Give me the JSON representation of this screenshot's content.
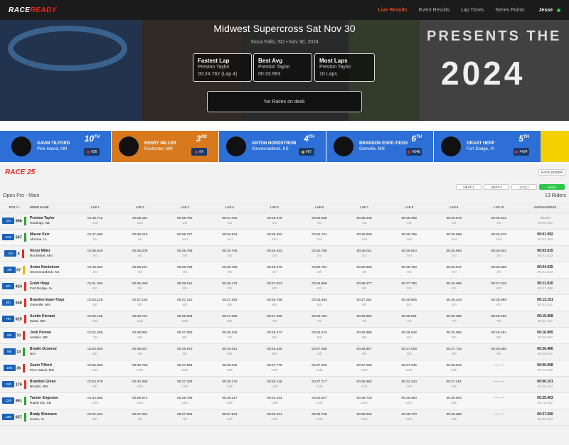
{
  "nav": {
    "logo_a": "RACE",
    "logo_b": "READY",
    "links": [
      "Live Results",
      "Event Results",
      "Lap Times",
      "Series Points"
    ],
    "active": "Live Results",
    "user": "Jesse"
  },
  "hero": {
    "title": "Midwest Supercross Sat Nov 30",
    "subtitle": "Sioux Falls, SD • Nov 30, 2024",
    "stats": [
      {
        "label": "Fastest Lap",
        "name": "Preston Taylor",
        "value": "00:24.762 (Lap 4)"
      },
      {
        "label": "Best Avg",
        "name": "Preston Taylor",
        "value": "00:33.993"
      },
      {
        "label": "Most Laps",
        "name": "Preston Taylor",
        "value": "10 Laps"
      }
    ],
    "ondeck": "No Races on deck",
    "art_text_a": "PRESENTS THE",
    "art_text_b": "2024"
  },
  "recent": [
    {
      "name": "GAVIN TILFORD",
      "loc": "Pine Island, MN",
      "pos": "10",
      "sup": "TH",
      "num": "#36",
      "color": "#2d6fd6",
      "dot": "#e8281e"
    },
    {
      "name": "HENRY MILLER",
      "loc": "Rochester, MN",
      "pos": "3",
      "sup": "RD",
      "num": "#X",
      "color": "#d9791e",
      "dot": "#e8281e"
    },
    {
      "name": "ANTON NORDSTROM",
      "loc": "Stromsnasbruk, KS",
      "pos": "4",
      "sup": "TH",
      "num": "#67",
      "color": "#2d6fd6",
      "dot": "#f4b400"
    },
    {
      "name": "BRANDON ESPE-TIEGS",
      "loc": "Glenville, MN",
      "pos": "6",
      "sup": "TH",
      "num": "#548",
      "color": "#2d6fd6",
      "dot": "#e8281e"
    },
    {
      "name": "GRANT HEPP",
      "loc": "Fort Dodge, IA",
      "pos": "5",
      "sup": "TH",
      "num": "#424",
      "color": "#2d6fd6",
      "dot": "#e8281e"
    }
  ],
  "race": {
    "title": "RACE 25",
    "race_order": "RACE ORDER",
    "class": "Open Pro - Main",
    "riders": "13 Riders",
    "heats": [
      "HEAT 1",
      "HEAT 2",
      "LCQ 1",
      "MAIN"
    ],
    "active_heat": "MAIN"
  },
  "table": {
    "headers": [
      "POS / #",
      "RIDER NAME",
      "LAP 1",
      "LAP 2",
      "LAP 3",
      "LAP 4",
      "LAP 5",
      "LAP 6",
      "LAP 7",
      "LAP 8",
      "LAP 9",
      "LAP 10",
      "GAP/LEAD/POS"
    ],
    "rows": [
      {
        "pos": "1st",
        "num": "996",
        "flag": "#2ca02c",
        "name": "Preston Taylor",
        "loc": "Hastings, NE",
        "laps": [
          [
            "01:48.712",
            "2nd"
          ],
          [
            "00:26.110",
            "2nd"
          ],
          [
            "00:25.750",
            "1st"
          ],
          [
            "00:24.762",
            "1st"
          ],
          [
            "00:25.370",
            "1st"
          ],
          [
            "00:25.236",
            "1st"
          ],
          [
            "00:25.240",
            "1st"
          ],
          [
            "00:26.459",
            "1st"
          ],
          [
            "00:25.579",
            "1st"
          ],
          [
            "00:26.812",
            "1st"
          ]
        ],
        "gap": [
          "--:--.---",
          "00:00.000"
        ]
      },
      {
        "pos": "2nd",
        "num": "597",
        "flag": "#2ca02c",
        "name": "Mason Kerr",
        "loc": "Altoona, IA",
        "laps": [
          [
            "01:47.680",
            "1st"
          ],
          [
            "00:26.010",
            "1st"
          ],
          [
            "00:25.727",
            "2nd"
          ],
          [
            "00:26.824",
            "2nd"
          ],
          [
            "00:25.452",
            "2nd"
          ],
          [
            "00:25.721",
            "2nd"
          ],
          [
            "00:26.000",
            "2nd"
          ],
          [
            "00:25.766",
            "2nd"
          ],
          [
            "00:25.996",
            "2nd"
          ],
          [
            "00:26.578",
            "2nd"
          ]
        ],
        "gap": [
          "00:01.992",
          "00:01.992"
        ]
      },
      {
        "pos": "3rd",
        "num": "X",
        "flag": "#e8281e",
        "name": "Henry Miller",
        "loc": "Rochester, MN",
        "laps": [
          [
            "01:50.545",
            "3rd"
          ],
          [
            "00:25.208",
            "3rd"
          ],
          [
            "00:25.788",
            "3rd"
          ],
          [
            "00:25.794",
            "3rd"
          ],
          [
            "00:26.433",
            "3rd"
          ],
          [
            "00:25.750",
            "3rd"
          ],
          [
            "00:25.011",
            "3rd"
          ],
          [
            "00:25.810",
            "3rd"
          ],
          [
            "00:25.963",
            "3rd"
          ],
          [
            "00:26.823",
            "3rd"
          ]
        ],
        "gap": [
          "00:03.015",
          "00:01.023"
        ]
      },
      {
        "pos": "4th",
        "num": "67",
        "flag": "#f4b400",
        "name": "Anton Nordstrom",
        "loc": "Stromsnasbruk, KS",
        "laps": [
          [
            "01:49.563",
            "3rd"
          ],
          [
            "00:26.167",
            "4th"
          ],
          [
            "00:26.798",
            "4th"
          ],
          [
            "00:25.785",
            "4th"
          ],
          [
            "00:25.479",
            "4th"
          ],
          [
            "00:26.781",
            "4th"
          ],
          [
            "00:26.953",
            "4th"
          ],
          [
            "00:25.794",
            "4th"
          ],
          [
            "00:26.047",
            "4th"
          ],
          [
            "00:26.568",
            "4th"
          ]
        ],
        "gap": [
          "00:04.025",
          "00:01.010"
        ]
      },
      {
        "pos": "5th",
        "num": "424",
        "flag": "#e8281e",
        "name": "Grant Hepp",
        "loc": "Fort Dodge, IA",
        "laps": [
          [
            "01:51.393",
            "5th"
          ],
          [
            "00:25.458",
            "5th"
          ],
          [
            "00:26.014",
            "5th"
          ],
          [
            "00:26.473",
            "5th"
          ],
          [
            "00:27.023",
            "5th"
          ],
          [
            "00:26.958",
            "5th"
          ],
          [
            "00:26.277",
            "5th"
          ],
          [
            "00:27.756",
            "5th"
          ],
          [
            "00:26.968",
            "5th"
          ],
          [
            "00:27.519",
            "5th"
          ]
        ],
        "gap": [
          "00:11.910",
          "00:07.885"
        ]
      },
      {
        "pos": "6th",
        "num": "548",
        "flag": "#e8281e",
        "name": "Brandon Espe-Tiegs",
        "loc": "Glenville, MN",
        "laps": [
          [
            "01:53.125",
            "6th"
          ],
          [
            "00:27.155",
            "6th"
          ],
          [
            "00:27.210",
            "6th"
          ],
          [
            "00:27.352",
            "6th"
          ],
          [
            "00:26.756",
            "6th"
          ],
          [
            "00:25.483",
            "6th"
          ],
          [
            "00:27.261",
            "6th"
          ],
          [
            "00:26.506",
            "6th"
          ],
          [
            "00:26.234",
            "6th"
          ],
          [
            "00:25.999",
            "6th"
          ]
        ],
        "gap": [
          "00:13.151",
          "00:01.241"
        ]
      },
      {
        "pos": "7th",
        "num": "625",
        "flag": "#e8281e",
        "name": "Austin Kienast",
        "loc": "Isanti, MN",
        "laps": [
          [
            "01:56.102",
            "12th"
          ],
          [
            "00:28.737",
            "11th"
          ],
          [
            "00:25.683",
            "10th"
          ],
          [
            "00:27.069",
            "8th"
          ],
          [
            "00:27.460",
            "7th"
          ],
          [
            "00:25.784",
            "7th"
          ],
          [
            "00:25.994",
            "7th"
          ],
          [
            "00:25.621",
            "7th"
          ],
          [
            "00:25.989",
            "7th"
          ],
          [
            "00:26.499",
            "7th"
          ]
        ],
        "gap": [
          "00:15.908",
          "00:02.757"
        ]
      },
      {
        "pos": "8th",
        "num": "70",
        "flag": "#e8281e",
        "name": "Josh Pennar",
        "loc": "Ixtellier, MB",
        "laps": [
          [
            "01:52.269",
            "7th"
          ],
          [
            "00:28.862",
            "8th"
          ],
          [
            "00:27.280",
            "8th"
          ],
          [
            "00:28.183",
            "7th"
          ],
          [
            "00:25.472",
            "8th"
          ],
          [
            "00:26.274",
            "8th"
          ],
          [
            "00:25.990",
            "8th"
          ],
          [
            "00:26.046",
            "8th"
          ],
          [
            "00:25.955",
            "8th"
          ],
          [
            "00:26.494",
            "8th"
          ]
        ],
        "gap": [
          "00:16.895",
          "00:00.987"
        ]
      },
      {
        "pos": "9th",
        "num": "13",
        "flag": "#2ca02c",
        "name": "Brodie Oconnor",
        "loc": "N/A",
        "laps": [
          [
            "01:53.983",
            "8th"
          ],
          [
            "00:28.627",
            "9th"
          ],
          [
            "00:26.970",
            "9th"
          ],
          [
            "00:29.011",
            "9th"
          ],
          [
            "00:28.436",
            "9th"
          ],
          [
            "00:27.258",
            "9th"
          ],
          [
            "00:28.807",
            "9th"
          ],
          [
            "00:27.029",
            "9th"
          ],
          [
            "00:27.715",
            "9th"
          ],
          [
            "00:28.560",
            "9th"
          ]
        ],
        "gap": [
          "00:26.486",
          "00:09.571"
        ]
      },
      {
        "pos": "10th",
        "num": "36",
        "flag": "#e8281e",
        "name": "Gavin Tilford",
        "loc": "Pine Island, MN",
        "laps": [
          [
            "01:56.983",
            "13th"
          ],
          [
            "00:28.758",
            "12th"
          ],
          [
            "00:27.865",
            "11th"
          ],
          [
            "00:29.222",
            "10th"
          ],
          [
            "00:27.775",
            "10th"
          ],
          [
            "00:27.229",
            "10th"
          ],
          [
            "00:27.032",
            "10th"
          ],
          [
            "00:27.245",
            "10th"
          ],
          [
            "00:28.819",
            "10th"
          ],
          [
            "--:--.---",
            "-"
          ]
        ],
        "gap": [
          "00:00.998",
          "00:23.468"
        ]
      },
      {
        "pos": "11th",
        "num": "176",
        "flag": "#e8281e",
        "name": "Brandon Green",
        "loc": "Brooks, MN",
        "laps": [
          [
            "01:53.978",
            "9th"
          ],
          [
            "00:34.358",
            "13th"
          ],
          [
            "00:27.246",
            "12th"
          ],
          [
            "00:28.170",
            "12th"
          ],
          [
            "00:28.128",
            "12th"
          ],
          [
            "00:27.717",
            "11th"
          ],
          [
            "00:26.992",
            "11th"
          ],
          [
            "00:32.243",
            "11th"
          ],
          [
            "00:27.251",
            "11th"
          ],
          [
            "--:--.---",
            "-"
          ]
        ],
        "gap": [
          "00:06.151",
          "00:06.153"
        ]
      },
      {
        "pos": "12th",
        "num": "991",
        "flag": "#2ca02c",
        "name": "Tanner Engesser",
        "loc": "Rapid city, SD",
        "laps": [
          [
            "01:54.882",
            "10th"
          ],
          [
            "00:29.972",
            "10th"
          ],
          [
            "00:28.759",
            "13th"
          ],
          [
            "00:29.217",
            "13th"
          ],
          [
            "00:31.242",
            "13th"
          ],
          [
            "00:33.527",
            "12th"
          ],
          [
            "00:38.719",
            "12th"
          ],
          [
            "00:29.490",
            "12th"
          ],
          [
            "00:30.504",
            "12th"
          ],
          [
            "--:--.---",
            "-"
          ]
        ],
        "gap": [
          "00:25.403",
          "00:19.252"
        ]
      },
      {
        "pos": "13th",
        "num": "657",
        "flag": "#2ca02c",
        "name": "Brady Sitzmann",
        "loc": "Ixnton, IA",
        "laps": [
          [
            "01:52.264",
            "6th"
          ],
          [
            "00:27.091",
            "7th"
          ],
          [
            "00:27.226",
            "7th"
          ],
          [
            "00:57.531",
            "11th"
          ],
          [
            "00:29.221",
            "11th"
          ],
          [
            "00:28.748",
            "13th"
          ],
          [
            "00:28.034",
            "13th"
          ],
          [
            "00:28.773",
            "13th"
          ],
          [
            "00:28.698",
            "13th"
          ],
          [
            "--:--.---",
            "-"
          ]
        ],
        "gap": [
          "00:27.656",
          "00:02.253"
        ]
      }
    ]
  }
}
